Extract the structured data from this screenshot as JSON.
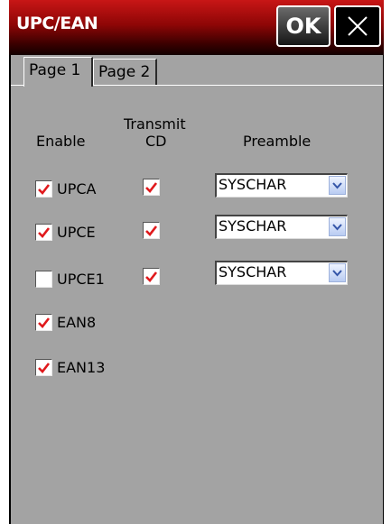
{
  "window": {
    "title": "UPC/EAN",
    "ok_label": "OK"
  },
  "tabs": [
    {
      "label": "Page 1",
      "active": true
    },
    {
      "label": "Page 2",
      "active": false
    }
  ],
  "headers": {
    "enable": "Enable",
    "transmit_line1": "Transmit",
    "transmit_line2": "CD",
    "preamble": "Preamble"
  },
  "rows": [
    {
      "label": "UPCA",
      "enabled": true,
      "transmit_cd": true,
      "preamble": "SYSCHAR"
    },
    {
      "label": "UPCE",
      "enabled": true,
      "transmit_cd": true,
      "preamble": "SYSCHAR"
    },
    {
      "label": "UPCE1",
      "enabled": false,
      "transmit_cd": true,
      "preamble": "SYSCHAR"
    },
    {
      "label": "EAN8",
      "enabled": true
    },
    {
      "label": "EAN13",
      "enabled": true
    }
  ],
  "colors": {
    "check": "#e0191c",
    "panel": "#a3a3a3",
    "title_bar": "#8e0606"
  }
}
